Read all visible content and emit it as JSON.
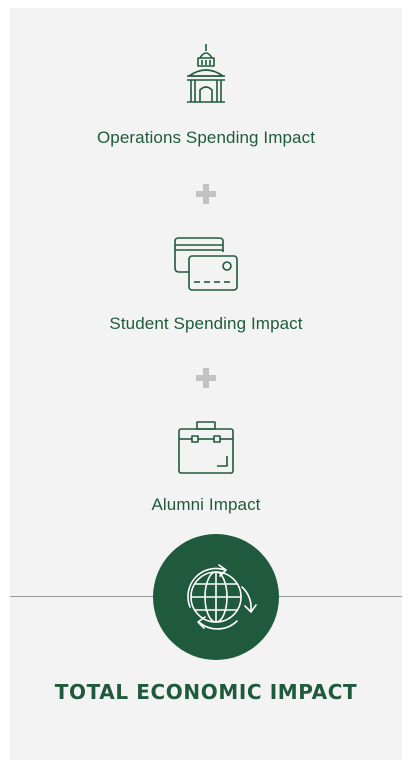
{
  "colors": {
    "brand_green": "#1f5a3c",
    "background": "#f3f3f3",
    "plus_gray": "#c3c3c3"
  },
  "items": [
    {
      "label": "Operations Spending Impact",
      "icon": "building-dome-icon"
    },
    {
      "label": "Student Spending Impact",
      "icon": "credit-cards-icon"
    },
    {
      "label": "Alumni Impact",
      "icon": "briefcase-icon"
    }
  ],
  "total": {
    "label": "TOTAL ECONOMIC IMPACT",
    "icon": "globe-cycle-icon"
  }
}
